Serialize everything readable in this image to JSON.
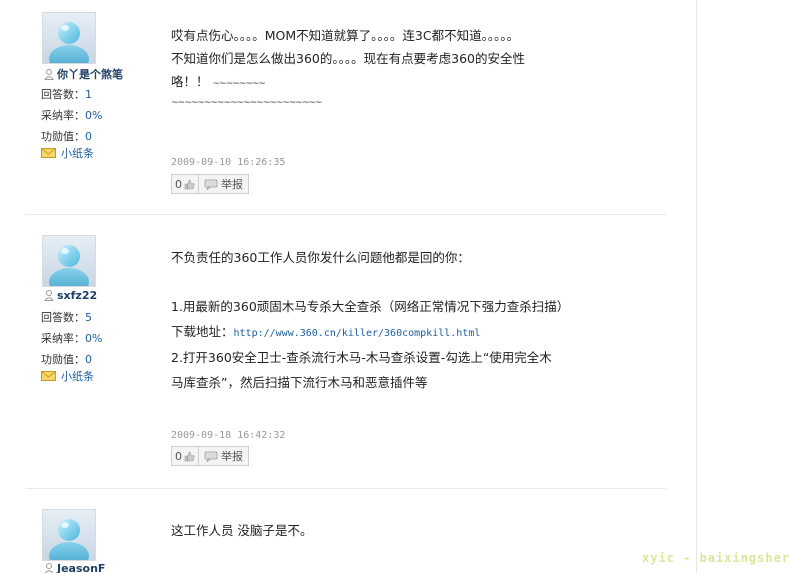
{
  "posts": [
    {
      "username": "你丫是个煞笔",
      "answers_label": "回答数：",
      "answers": "1",
      "adopt_label": "采纳率：",
      "adopt": "0%",
      "points_label": "功勋值：",
      "points": "0",
      "note_label": "小纸条",
      "lines": [
        "哎有点伤心。。。。MOM不知道就算了。。。。连3C都不知道。。。。。",
        "不知道你们是怎么做出360的。。。。现在有点要考虑360的安全性",
        "咯！！"
      ],
      "wavy1": "~~~~~~~~",
      "wavy2": "~~~~~~~~~~~~~~~~~~~~~~~",
      "time": "2009-09-10 16:26:35",
      "count": "0",
      "report_label": "举报"
    },
    {
      "username": "sxfz22",
      "answers_label": "回答数：",
      "answers": "5",
      "adopt_label": "采纳率：",
      "adopt": "0%",
      "points_label": "功勋值：",
      "points": "0",
      "note_label": "小纸条",
      "line1": "不负责任的360工作人员你发什么问题他都是回的你：",
      "line2": "1.用最新的360顽固木马专杀大全查杀（网络正常情况下强力查杀扫描）",
      "download_label": "下载地址：",
      "url": "http://www.360.cn/killer/360compkill.html",
      "line4": "2.打开360安全卫士-查杀流行木马-木马查杀设置-勾选上“使用完全木",
      "line5": "马库查杀”，然后扫描下流行木马和恶意插件等",
      "time": "2009-09-18 16:42:32",
      "count": "0",
      "report_label": "举报"
    },
    {
      "username": "JeasonF",
      "line1": "这工作人员 没脑子是不。"
    }
  ],
  "watermark": "xyic - baixingsheru",
  "icons": [
    "avatar-icon",
    "user-icon",
    "mail-icon",
    "thumb-up-icon",
    "report-flag-icon"
  ]
}
